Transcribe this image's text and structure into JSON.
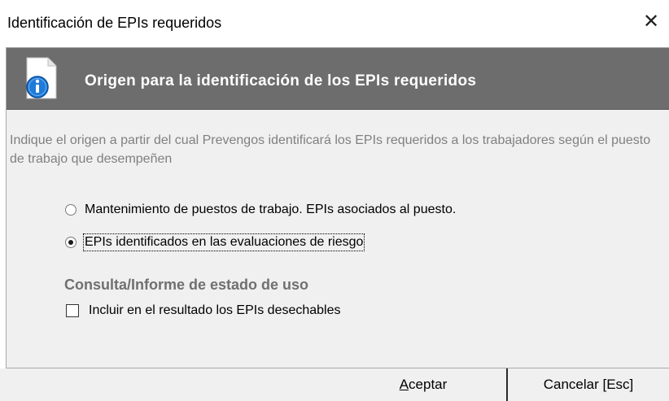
{
  "window": {
    "title": "Identificación de EPIs requeridos",
    "close_glyph": "✕",
    "close_icon": "close-icon"
  },
  "header": {
    "icon": "info-document-icon",
    "title": "Origen para la identificación de los EPIs requeridos",
    "band_color": "#6d6d6d"
  },
  "description": "Indique el origen a partir del cual Prevengos identificará los EPIs requeridos a los trabajadores según el puesto de trabajo que desempeñen",
  "source_options": [
    {
      "label": "Mantenimiento de puestos de trabajo. EPIs asociados al puesto.",
      "checked": false
    },
    {
      "label": "EPIs identificados en las evaluaciones de riesgo",
      "checked": true
    }
  ],
  "usage_section": {
    "title": "Consulta/Informe de estado de uso",
    "include_disposable_label": "Incluir en el resultado los EPIs desechables",
    "include_disposable_checked": false
  },
  "buttons": {
    "accept_accel": "A",
    "accept_rest": "ceptar",
    "cancel_label": "Cancelar [Esc]"
  }
}
